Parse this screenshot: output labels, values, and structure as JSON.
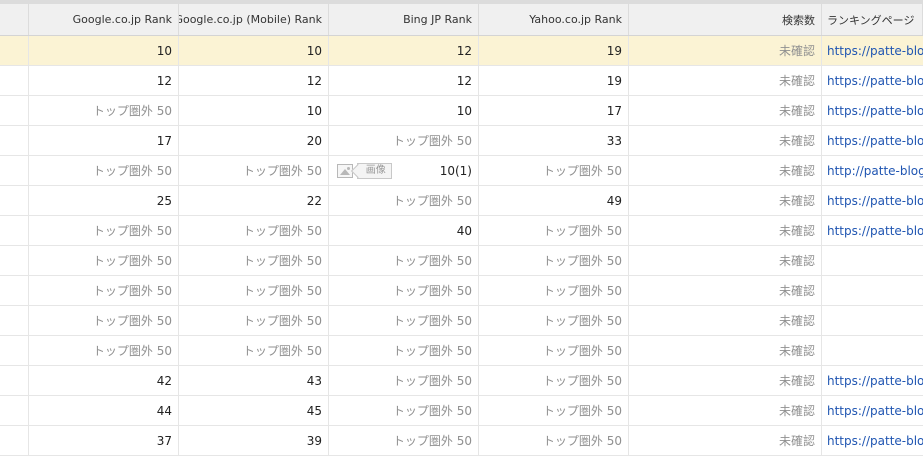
{
  "headers": [
    "",
    "Google.co.jp Rank",
    "Google.co.jp (Mobile) Rank",
    "Bing JP Rank",
    "Yahoo.co.jp Rank",
    "検索数",
    "ランキングページ"
  ],
  "image_tag": "画像",
  "rows": [
    {
      "google": "10",
      "mobile": "10",
      "bing": "12",
      "yahoo": "19",
      "searches": "未確認",
      "url": "https://patte-blog.c",
      "highlight": true
    },
    {
      "google": "12",
      "mobile": "12",
      "bing": "12",
      "yahoo": "19",
      "searches": "未確認",
      "url": "https://patte-blog.c"
    },
    {
      "google": "トップ圏外 50",
      "mobile": "10",
      "bing": "10",
      "yahoo": "17",
      "searches": "未確認",
      "url": "https://patte-blog.c"
    },
    {
      "google": "17",
      "mobile": "20",
      "bing": "トップ圏外 50",
      "yahoo": "33",
      "searches": "未確認",
      "url": "https://patte-blog.c"
    },
    {
      "google": "トップ圏外 50",
      "mobile": "トップ圏外 50",
      "bing": "10(1)",
      "yahoo": "トップ圏外 50",
      "searches": "未確認",
      "url": "http://patte-blog.co",
      "image": true
    },
    {
      "google": "25",
      "mobile": "22",
      "bing": "トップ圏外 50",
      "yahoo": "49",
      "searches": "未確認",
      "url": "https://patte-blog.c"
    },
    {
      "google": "トップ圏外 50",
      "mobile": "トップ圏外 50",
      "bing": "40",
      "yahoo": "トップ圏外 50",
      "searches": "未確認",
      "url": "https://patte-blog.c"
    },
    {
      "google": "トップ圏外 50",
      "mobile": "トップ圏外 50",
      "bing": "トップ圏外 50",
      "yahoo": "トップ圏外 50",
      "searches": "未確認",
      "url": ""
    },
    {
      "google": "トップ圏外 50",
      "mobile": "トップ圏外 50",
      "bing": "トップ圏外 50",
      "yahoo": "トップ圏外 50",
      "searches": "未確認",
      "url": ""
    },
    {
      "google": "トップ圏外 50",
      "mobile": "トップ圏外 50",
      "bing": "トップ圏外 50",
      "yahoo": "トップ圏外 50",
      "searches": "未確認",
      "url": ""
    },
    {
      "google": "トップ圏外 50",
      "mobile": "トップ圏外 50",
      "bing": "トップ圏外 50",
      "yahoo": "トップ圏外 50",
      "searches": "未確認",
      "url": ""
    },
    {
      "google": "42",
      "mobile": "43",
      "bing": "トップ圏外 50",
      "yahoo": "トップ圏外 50",
      "searches": "未確認",
      "url": "https://patte-blog.c"
    },
    {
      "google": "44",
      "mobile": "45",
      "bing": "トップ圏外 50",
      "yahoo": "トップ圏外 50",
      "searches": "未確認",
      "url": "https://patte-blog.c"
    },
    {
      "google": "37",
      "mobile": "39",
      "bing": "トップ圏外 50",
      "yahoo": "トップ圏外 50",
      "searches": "未確認",
      "url": "https://patte-blog.c"
    }
  ],
  "colors": {
    "highlight": "#fbf3d4",
    "link": "#1f55b2",
    "muted": "#909090"
  }
}
